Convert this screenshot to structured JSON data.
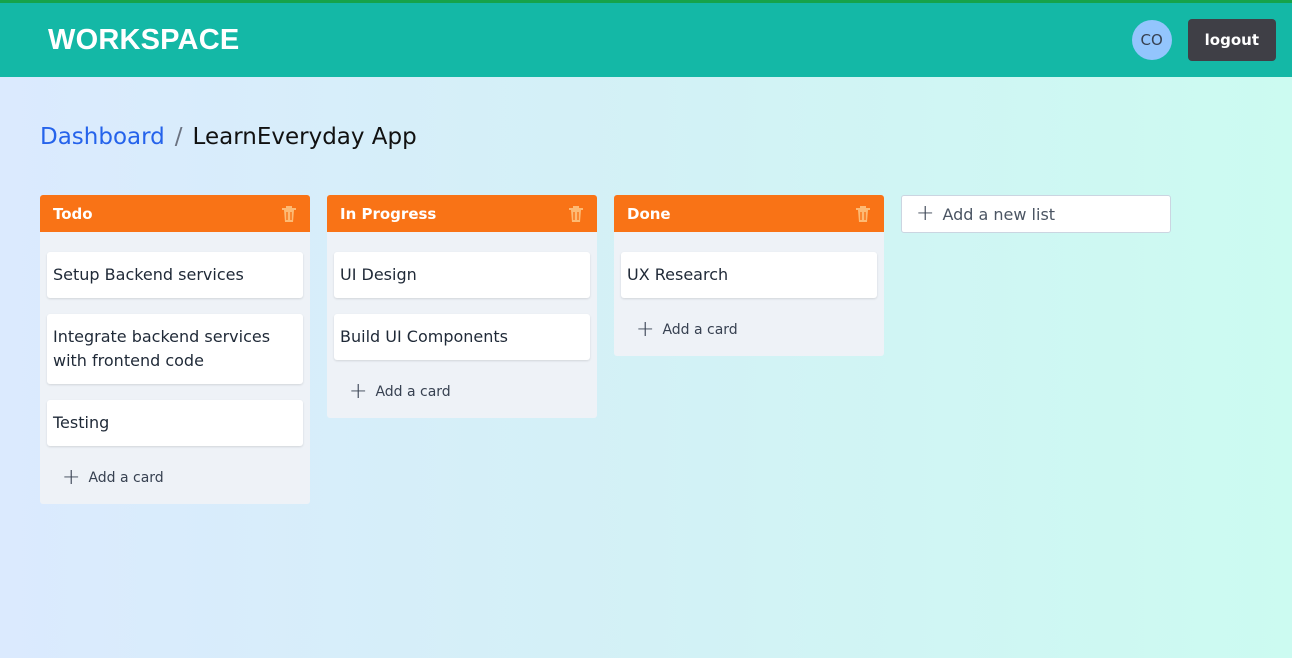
{
  "header": {
    "brand": "WORKSPACE",
    "avatar_initials": "CO",
    "logout_label": "logout"
  },
  "breadcrumb": {
    "parent": "Dashboard",
    "separator": "/",
    "current": "LearnEveryday App"
  },
  "lists": [
    {
      "title": "Todo",
      "cards": [
        "Setup Backend services",
        "Integrate backend services with frontend code",
        "Testing"
      ],
      "add_card_label": "Add a card"
    },
    {
      "title": "In Progress",
      "cards": [
        "UI Design",
        "Build UI Components"
      ],
      "add_card_label": "Add a card"
    },
    {
      "title": "Done",
      "cards": [
        "UX Research"
      ],
      "add_card_label": "Add a card"
    }
  ],
  "add_list_label": "Add a new list",
  "icons": {
    "delete": "trash-icon",
    "add": "plus-icon"
  },
  "colors": {
    "header": "#14b8a6",
    "list_header": "#f97316",
    "link": "#2563eb",
    "logout": "#3f3f46",
    "avatar": "#93c5fd"
  }
}
